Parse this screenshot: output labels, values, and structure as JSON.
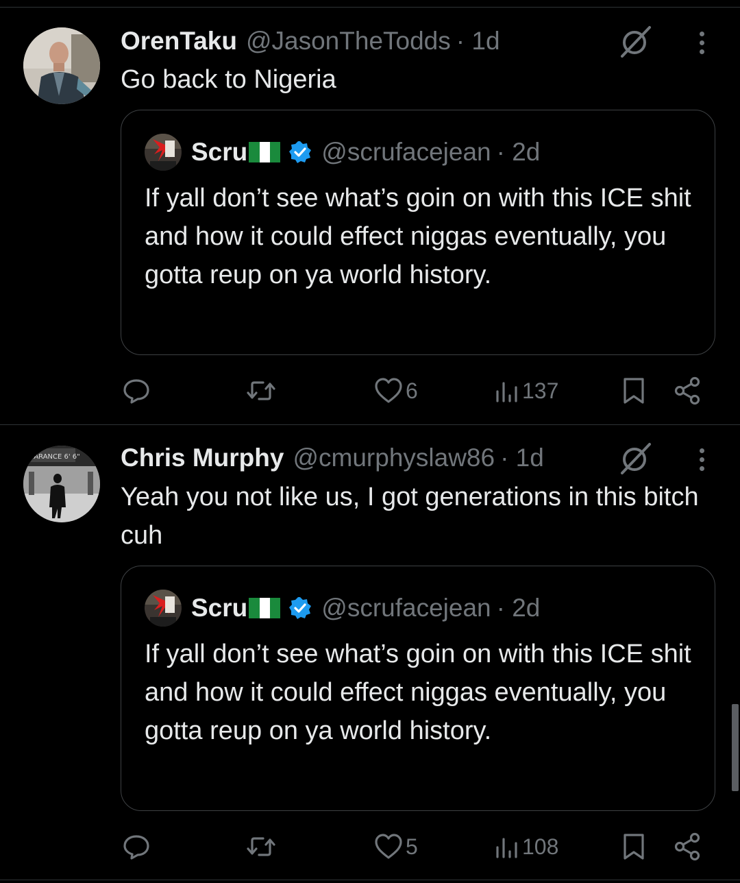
{
  "tweets": [
    {
      "name": "OrenTaku",
      "handle": "@JasonTheTodds",
      "time": "· 1d",
      "text": "Go back to Nigeria",
      "quote": {
        "name": "Scru",
        "handle": "@scrufacejean",
        "time": "· 2d",
        "text": "If yall don’t see what’s goin on with this ICE shit and how it could effect niggas eventually, you gotta reup on ya world history."
      },
      "likes": "6",
      "views": "137"
    },
    {
      "name": "Chris Murphy",
      "handle": "@cmurphyslaw86",
      "time": "· 1d",
      "text": "Yeah you not like us, I got generations in this bitch cuh",
      "quote": {
        "name": "Scru",
        "handle": "@scrufacejean",
        "time": "· 2d",
        "text": "If yall don’t see what’s goin on with this ICE shit and how it could effect niggas eventually, you gotta reup on ya world history."
      },
      "likes": "5",
      "views": "108"
    }
  ],
  "avatar2_sign_text": "EARANCE 6' 6\"",
  "colors": {
    "background": "#000000",
    "text": "#e7e9ea",
    "secondary": "#71767b",
    "border": "#2f3336",
    "verified": "#1d9bf0",
    "flag_green": "#1a8a3c",
    "flag_white": "#ffffff"
  },
  "icons": [
    "grok-icon",
    "more-icon",
    "reply-icon",
    "retweet-icon",
    "heart-icon",
    "views-icon",
    "bookmark-icon",
    "share-icon",
    "verified-badge-icon",
    "nigeria-flag-icon"
  ]
}
